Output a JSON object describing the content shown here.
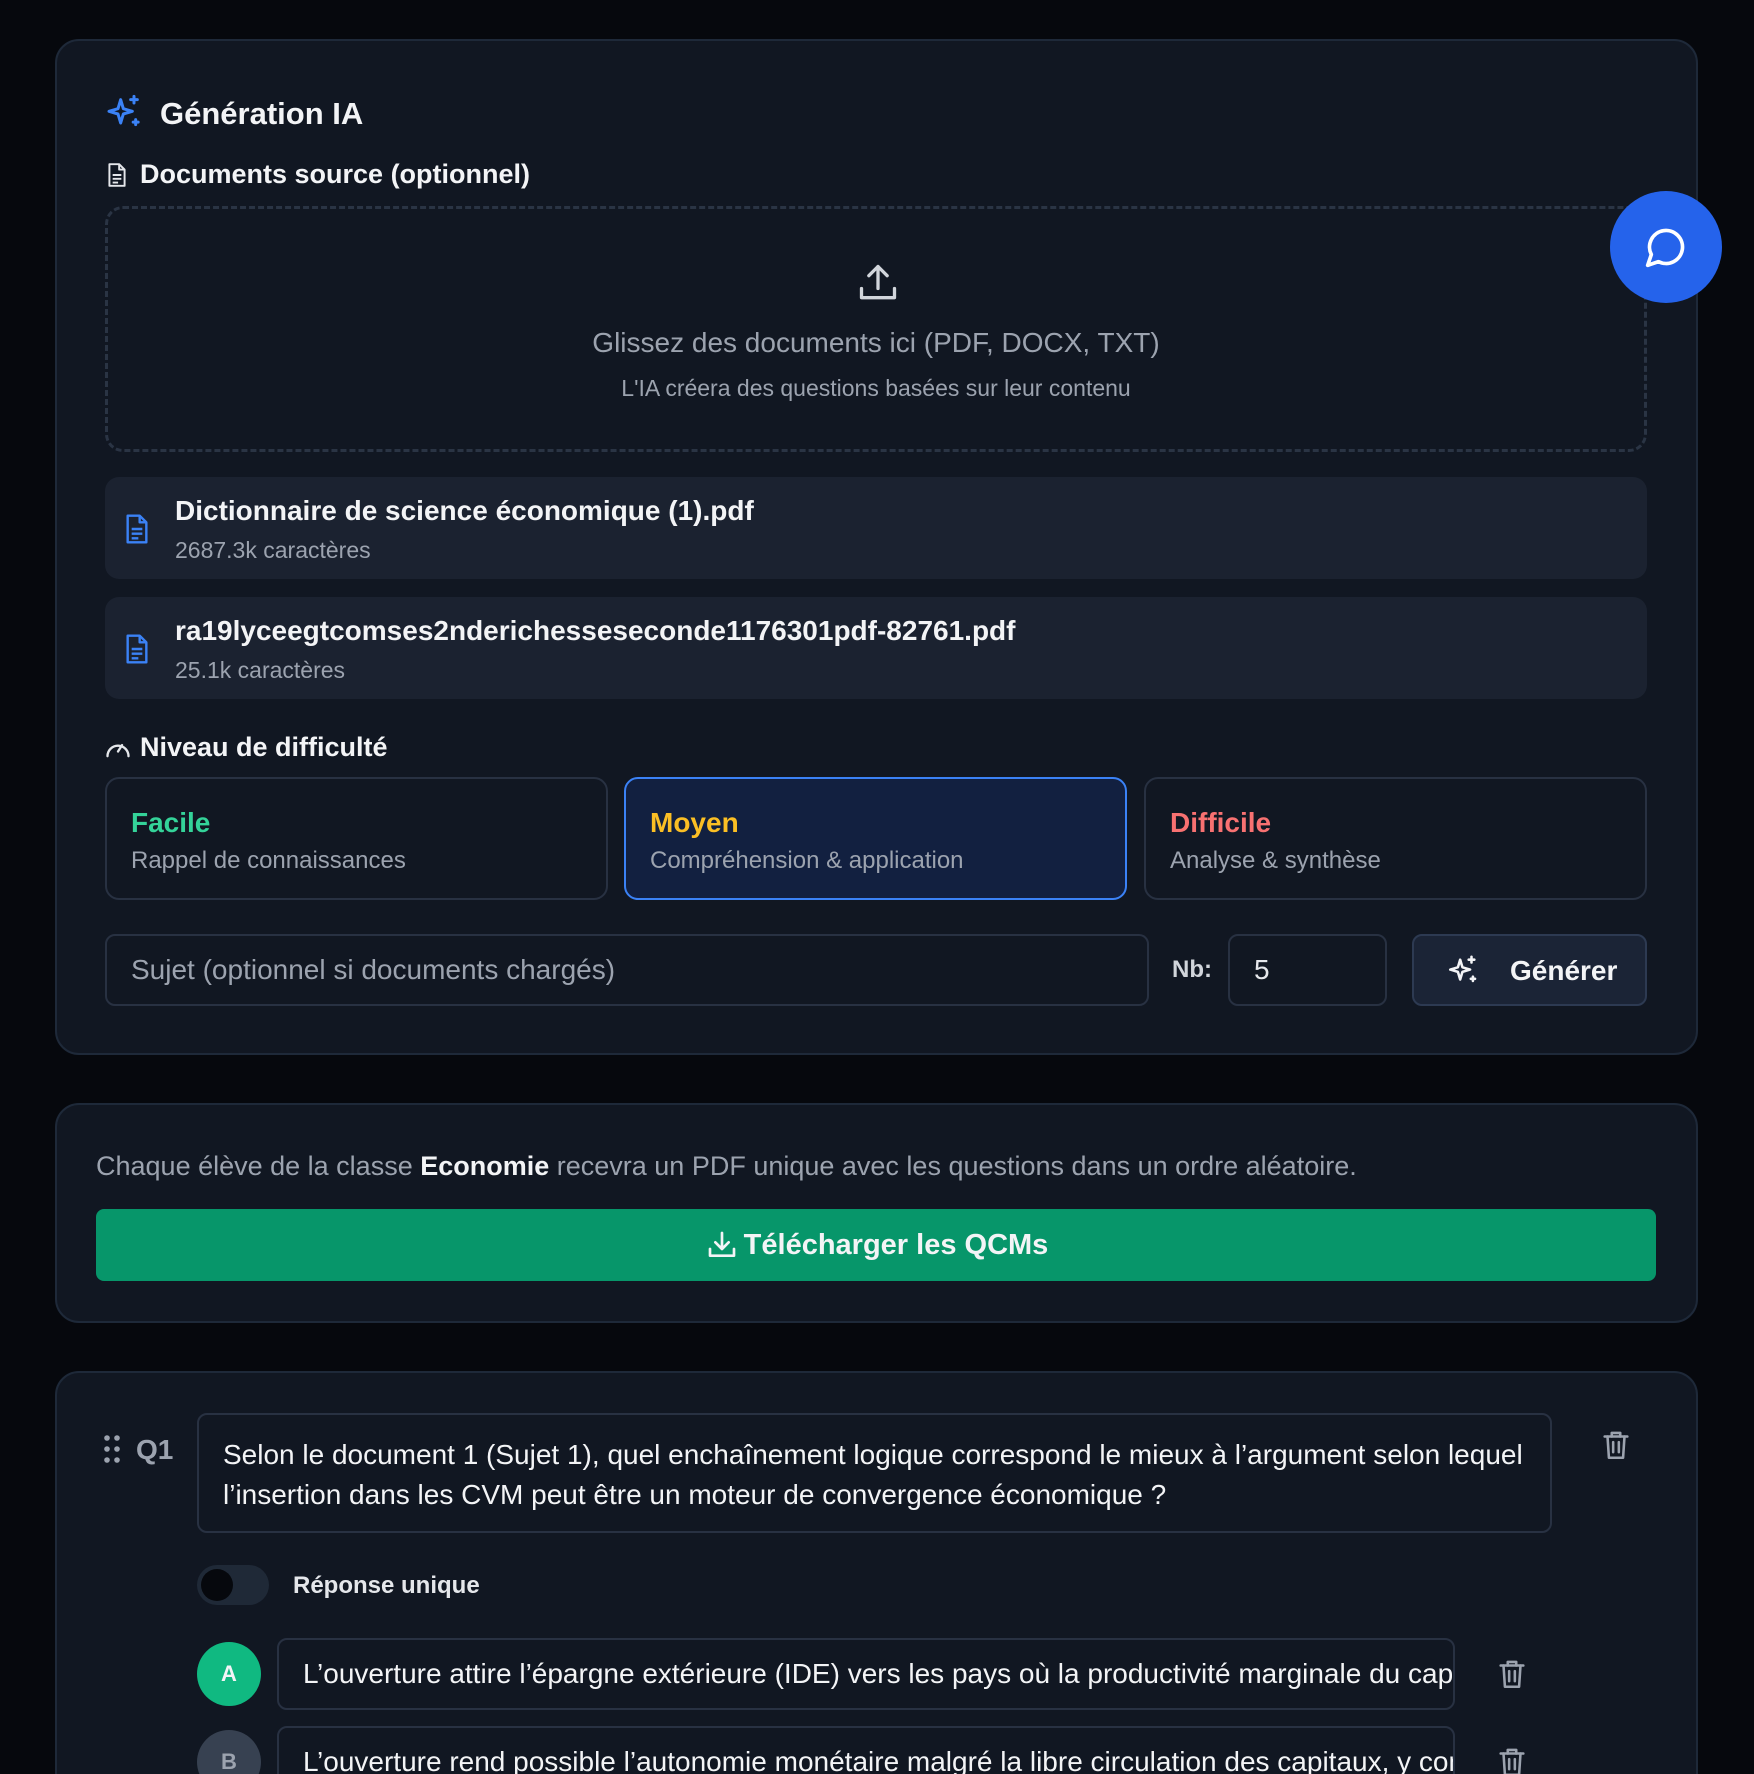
{
  "header": {
    "title": "Génération IA"
  },
  "sources": {
    "label": "Documents source (optionnel)",
    "dropzone_main": "Glissez des documents ici (PDF, DOCX, TXT)",
    "dropzone_sub": "L'IA créera des questions basées sur leur contenu",
    "files": [
      {
        "name": "Dictionnaire de science économique (1).pdf",
        "size": "2687.3k caractères"
      },
      {
        "name": "ra19lyceegtcomses2nderichesseseconde1176301pdf-82761.pdf",
        "size": "25.1k caractères"
      }
    ]
  },
  "difficulty": {
    "label": "Niveau de difficulté",
    "options": [
      {
        "name": "Facile",
        "desc": "Rappel de connaissances",
        "color": "#34d399"
      },
      {
        "name": "Moyen",
        "desc": "Compréhension & application",
        "color": "#fbbf24",
        "selected": true
      },
      {
        "name": "Difficile",
        "desc": "Analyse & synthèse",
        "color": "#f87171"
      }
    ]
  },
  "generator": {
    "subject_placeholder": "Sujet (optionnel si documents chargés)",
    "nb_label": "Nb:",
    "nb_value": "5",
    "generate_label": "Générer"
  },
  "download": {
    "text_before": "Chaque élève de la classe ",
    "class_name": "Economie",
    "text_after": " recevra un PDF unique avec les questions dans un ordre aléatoire.",
    "button_label": "Télécharger les QCMs"
  },
  "question": {
    "label": "Q1",
    "text": "Selon le document 1 (Sujet 1), quel enchaînement logique correspond le mieux à l’argument selon lequel l’insertion dans les CVM peut être un moteur de convergence économique ?",
    "toggle_label": "Réponse unique",
    "options": [
      {
        "letter": "A",
        "text": "L’ouverture attire l’épargne extérieure (IDE) vers les pays où la productivité marginale du capital",
        "badge_color": "#10b981"
      },
      {
        "letter": "B",
        "text": "L’ouverture rend possible l’autonomie monétaire malgré la libre circulation des capitaux, y compris",
        "badge_color": "#374151"
      }
    ]
  },
  "colors": {
    "accent": "#3b82f6",
    "success": "#07966a",
    "fab": "#2563eb"
  }
}
